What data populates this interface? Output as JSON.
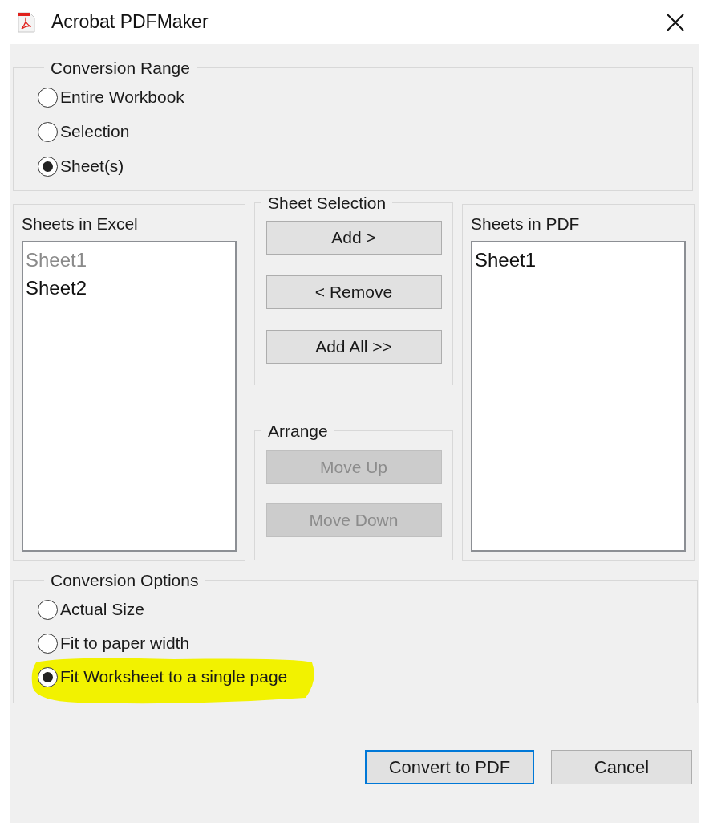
{
  "window": {
    "title": "Acrobat PDFMaker"
  },
  "conversion_range": {
    "title": "Conversion Range",
    "options": [
      {
        "label": "Entire Workbook",
        "selected": false
      },
      {
        "label": "Selection",
        "selected": false
      },
      {
        "label": "Sheet(s)",
        "selected": true
      }
    ]
  },
  "sheets_in_excel": {
    "title": "Sheets in Excel",
    "items": [
      {
        "label": "Sheet1",
        "disabled": true
      },
      {
        "label": "Sheet2",
        "disabled": false
      }
    ]
  },
  "sheet_selection": {
    "title": "Sheet Selection",
    "buttons": [
      {
        "label": "Add >",
        "disabled": false
      },
      {
        "label": "< Remove",
        "disabled": false
      },
      {
        "label": "Add All >>",
        "disabled": false
      }
    ]
  },
  "arrange": {
    "title": "Arrange",
    "buttons": [
      {
        "label": "Move Up",
        "disabled": true
      },
      {
        "label": "Move Down",
        "disabled": true
      }
    ]
  },
  "sheets_in_pdf": {
    "title": "Sheets in PDF",
    "items": [
      {
        "label": "Sheet1",
        "disabled": false
      }
    ]
  },
  "conversion_options": {
    "title": "Conversion Options",
    "options": [
      {
        "label": "Actual Size",
        "selected": false,
        "highlighted": false
      },
      {
        "label": "Fit to paper width",
        "selected": false,
        "highlighted": false
      },
      {
        "label": "Fit Worksheet to a single page",
        "selected": true,
        "highlighted": true
      }
    ]
  },
  "buttons": [
    {
      "label": "Convert to PDF",
      "default": true
    },
    {
      "label": "Cancel",
      "default": false
    }
  ]
}
